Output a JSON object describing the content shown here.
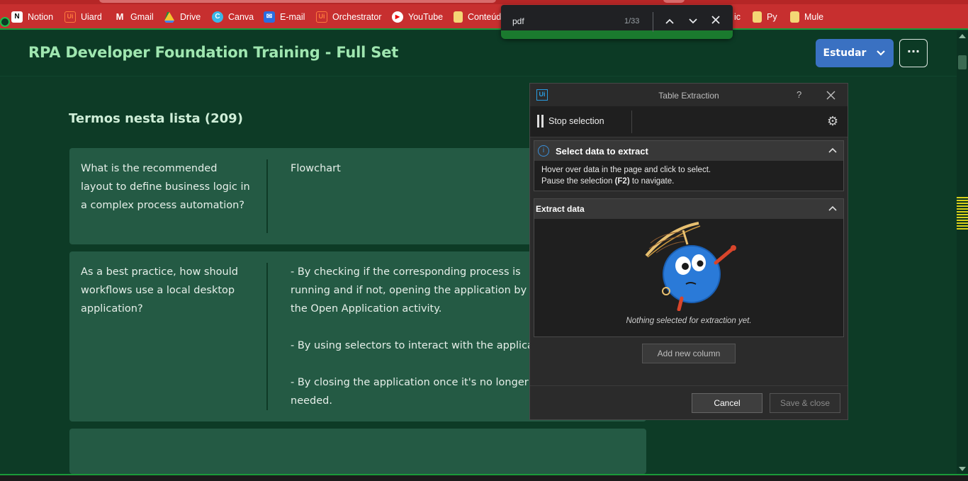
{
  "bookmarks": [
    {
      "label": "Notion",
      "icon": "notion-icon"
    },
    {
      "label": "Uiard",
      "icon": "uipath-icon"
    },
    {
      "label": "Gmail",
      "icon": "gmail-icon"
    },
    {
      "label": "Drive",
      "icon": "drive-icon"
    },
    {
      "label": "Canva",
      "icon": "canva-icon"
    },
    {
      "label": "E-mail",
      "icon": "mail-icon"
    },
    {
      "label": "Orchestrator",
      "icon": "uipath-icon"
    },
    {
      "label": "YouTube",
      "icon": "youtube-icon"
    },
    {
      "label": "Conteúd",
      "icon": "folder-icon"
    },
    {
      "label": "ic",
      "icon": "none"
    },
    {
      "label": "Py",
      "icon": "folder-icon"
    },
    {
      "label": "Mule",
      "icon": "folder-icon"
    }
  ],
  "find_bar": {
    "query": "pdf",
    "count": "1/33"
  },
  "page": {
    "title": "RPA Developer Foundation Training - Full Set",
    "study_button": "Estudar",
    "terms_heading": "Termos nesta lista (209)",
    "cards": [
      {
        "term": "What is the recommended layout to define business logic in a complex process automation?",
        "definition": "Flowchart"
      },
      {
        "term": "As a best practice, how should workflows use a local desktop application?",
        "definition": "- By checking if the corresponding process is running and if not, opening the application by the Open Application activity.\n\n- By using selectors to interact with the applica\n\n- By closing the application once it's no longer needed."
      }
    ]
  },
  "dialog": {
    "logo": "Ui",
    "title": "Table Extraction",
    "help": "?",
    "stop_selection": "Stop selection",
    "select_section": {
      "title": "Select data to extract",
      "line1": "Hover over data in the page and click to select.",
      "line2_pre": "Pause the selection ",
      "line2_key": "(F2)",
      "line2_post": " to navigate."
    },
    "extract_section": {
      "title": "Extract data",
      "empty_text": "Nothing selected for extraction yet."
    },
    "add_column": "Add new column",
    "cancel": "Cancel",
    "save_close": "Save & close"
  },
  "colors": {
    "page_bg": "#0d3b26",
    "card_bg": "#245a44",
    "title_green": "#9fe6b0",
    "study_blue": "#3a71c2",
    "bookmark_bar": "#c72f2f",
    "dialog_bg": "#2b2b2b"
  }
}
